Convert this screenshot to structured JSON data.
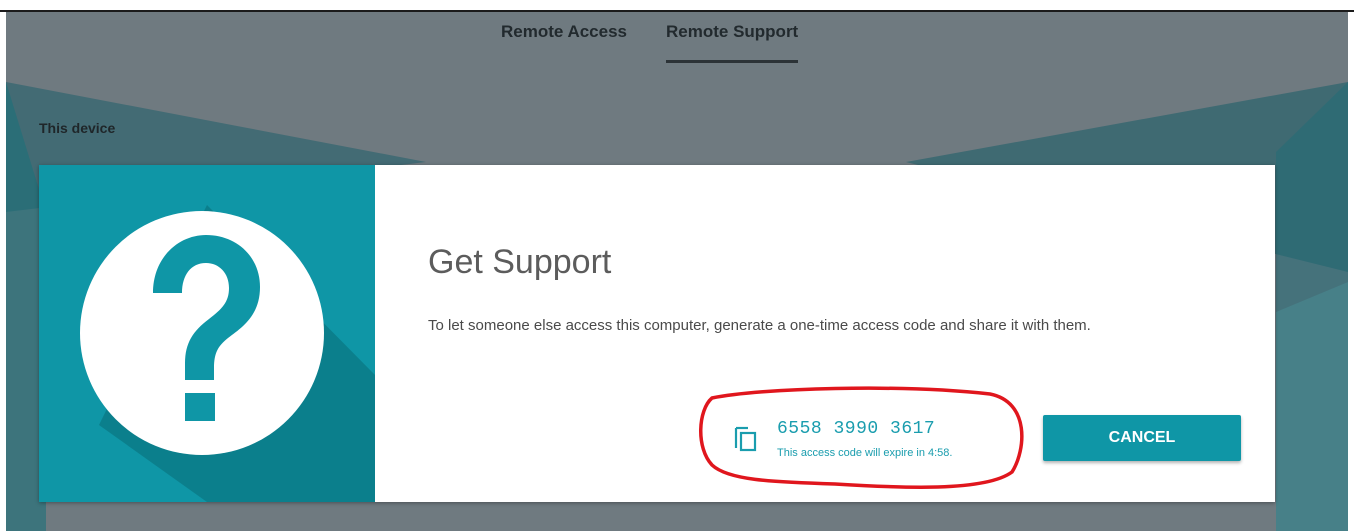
{
  "tabs": [
    {
      "label": "Remote Access"
    },
    {
      "label": "Remote Support"
    }
  ],
  "active_tab": "Remote Support",
  "section": {
    "label": "This device"
  },
  "card": {
    "title": "Get Support",
    "description": "To let someone else access this computer, generate a one-time access code and share it with them.",
    "access_code": "6558 3990 3617",
    "expire_text": "This access code will expire in 4:58.",
    "cancel_label": "CANCEL",
    "hero_icon": "question-mark-icon",
    "copy_icon": "copy-icon"
  },
  "colors": {
    "accent": "#0f96a6",
    "backdrop": "#6f7a80",
    "code_text": "#1a9dae",
    "annotation": "#e0161d"
  }
}
